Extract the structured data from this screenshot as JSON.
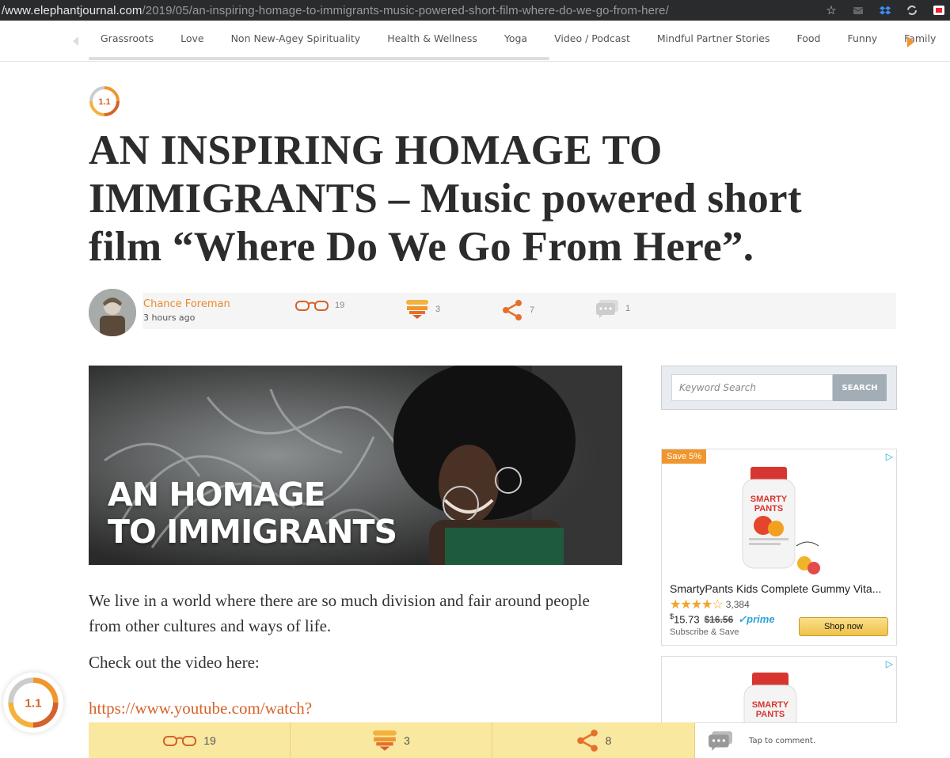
{
  "browser": {
    "url_host": "/www.elephantjournal.com",
    "url_path": "/2019/05/an-inspiring-homage-to-immigrants-music-powered-short-film-where-do-we-go-from-here/",
    "icons": [
      "star-icon",
      "envelope-icon",
      "dropbox-icon",
      "sync-icon",
      "extension-icon"
    ]
  },
  "nav": {
    "categories": [
      "Grassroots",
      "Love",
      "Non New-Agey Spirituality",
      "Health & Wellness",
      "Yoga",
      "Video / Podcast",
      "Mindful Partner Stories",
      "Food",
      "Funny",
      "Family"
    ]
  },
  "logo": {
    "text": "1.1"
  },
  "article": {
    "title": "AN INSPIRING HOMAGE TO IMMIGRANTS – Music powered short film “Where Do We Go From Here”.",
    "author": "Chance Foreman",
    "time": "3 hours ago",
    "reads": "19",
    "hearts": "3",
    "shares": "7",
    "comments": "1",
    "hero_line1": "AN HOMAGE",
    "hero_line2": "TO IMMIGRANTS",
    "para1": "We live in a world where there are so much division and fair around people from other cultures and ways of life.",
    "para2": "Check out the video here:",
    "link": "https://www.youtube.com/watch?"
  },
  "search": {
    "placeholder": "Keyword Search",
    "button": "SEARCH"
  },
  "ad": {
    "badge": "Save 5%",
    "brand_line1": "SMARTY",
    "brand_line2": "PANTS",
    "product": "SmartyPants Kids Complete Gummy Vita...",
    "stars": "★★★★☆",
    "rating_count": "3,384",
    "price_currency": "$",
    "price": "15.73",
    "old_price": "$16.56",
    "prime": "✓prime",
    "subscribe": "Subscribe & Save",
    "shop": "Shop now"
  },
  "bottom_bar": {
    "reads": "19",
    "hearts": "3",
    "shares": "8",
    "comment_prompt": "Tap to comment."
  },
  "colors": {
    "accent": "#f0962e",
    "link": "#d4622a",
    "bar": "#f9e8a0"
  }
}
